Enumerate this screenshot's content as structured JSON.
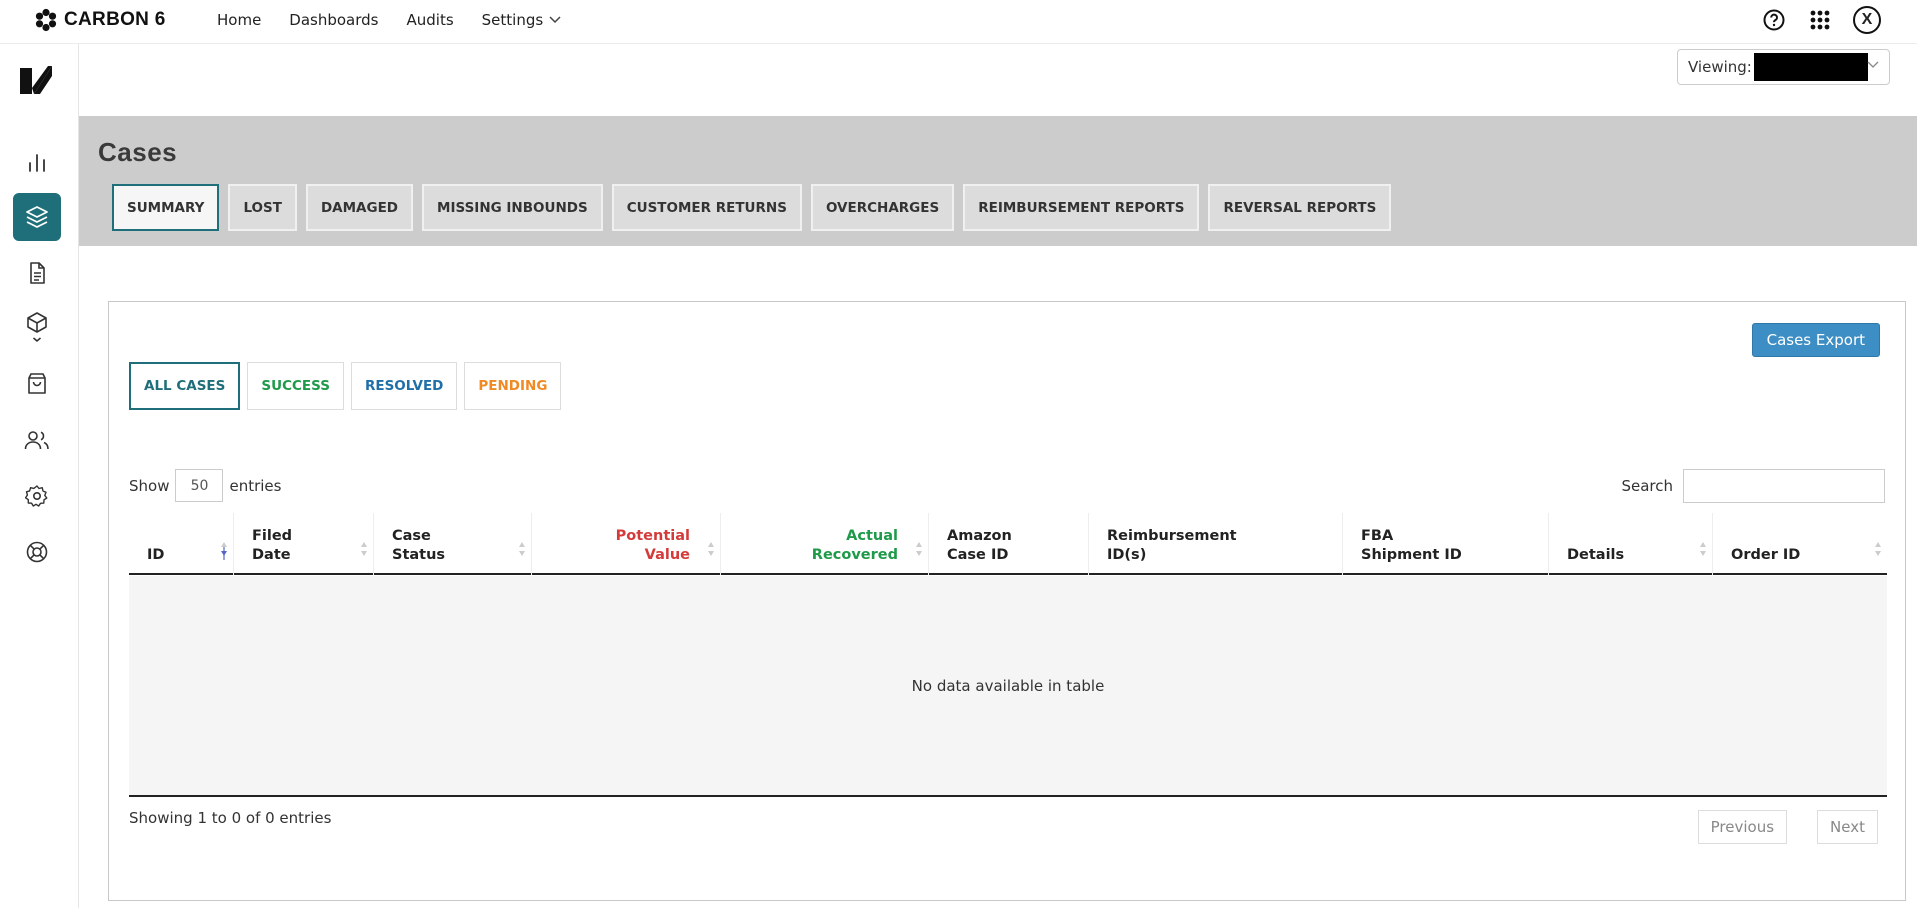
{
  "brand": {
    "name": "CARBON 6"
  },
  "nav": {
    "items": [
      {
        "label": "Home"
      },
      {
        "label": "Dashboards"
      },
      {
        "label": "Audits"
      },
      {
        "label": "Settings"
      }
    ]
  },
  "user": {
    "avatar_initial": "X"
  },
  "sidebar": {
    "items": [
      {
        "icon": "bar-chart-icon"
      },
      {
        "icon": "layers-icon",
        "active": true
      },
      {
        "icon": "document-icon"
      },
      {
        "icon": "package-icon"
      },
      {
        "icon": "shopping-bag-icon"
      },
      {
        "icon": "users-icon"
      },
      {
        "icon": "gear-icon"
      },
      {
        "icon": "lifebuoy-icon"
      }
    ]
  },
  "viewing": {
    "label": "Viewing:"
  },
  "page": {
    "title": "Cases"
  },
  "tabs": [
    {
      "label": "SUMMARY",
      "active": true
    },
    {
      "label": "LOST"
    },
    {
      "label": "DAMAGED"
    },
    {
      "label": "MISSING INBOUNDS"
    },
    {
      "label": "CUSTOMER RETURNS"
    },
    {
      "label": "OVERCHARGES"
    },
    {
      "label": "REIMBURSEMENT REPORTS"
    },
    {
      "label": "REVERSAL REPORTS"
    }
  ],
  "export": {
    "label": "Cases Export"
  },
  "filters": [
    {
      "label": "ALL CASES",
      "color": "#1f6f7a",
      "active": true
    },
    {
      "label": "SUCCESS",
      "color": "#1e9a4a"
    },
    {
      "label": "RESOLVED",
      "color": "#1f6fa8"
    },
    {
      "label": "PENDING",
      "color": "#f08a24"
    }
  ],
  "table": {
    "show_label": "Show",
    "entries_label": "entries",
    "page_length": "50",
    "search_label": "Search",
    "search_value": "",
    "columns": [
      {
        "line1": "",
        "line2": "ID"
      },
      {
        "line1": "Filed",
        "line2": "Date"
      },
      {
        "line1": "Case",
        "line2": "Status"
      },
      {
        "line1": "Potential",
        "line2": "Value",
        "color": "#d33b3b"
      },
      {
        "line1": "Actual",
        "line2": "Recovered",
        "color": "#1e9a4a"
      },
      {
        "line1": "Amazon",
        "line2": "Case ID"
      },
      {
        "line1": "Reimbursement",
        "line2": "ID(s)"
      },
      {
        "line1": "FBA",
        "line2": "Shipment ID"
      },
      {
        "line1": "",
        "line2": "Details"
      },
      {
        "line1": "",
        "line2": "Order ID"
      }
    ],
    "empty_message": "No data available in table",
    "info": "Showing 1 to 0 of 0 entries",
    "previous_label": "Previous",
    "next_label": "Next"
  }
}
